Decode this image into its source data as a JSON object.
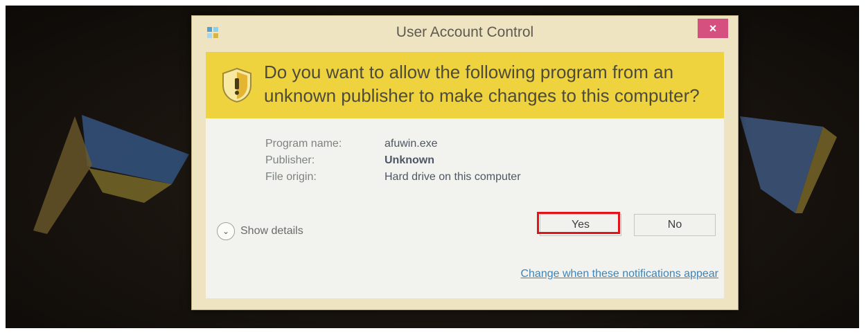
{
  "window": {
    "title": "User Account Control",
    "close_label": "×"
  },
  "banner": {
    "question": "Do you want to allow the following program from an unknown publisher to make changes to this computer?"
  },
  "details": {
    "program_name_label": "Program name:",
    "program_name_value": "afuwin.exe",
    "publisher_label": "Publisher:",
    "publisher_value": "Unknown",
    "file_origin_label": "File origin:",
    "file_origin_value": "Hard drive on this computer"
  },
  "actions": {
    "show_details": "Show details",
    "yes_label": "Yes",
    "no_label": "No",
    "change_notifications_link": "Change when these notifications appear"
  },
  "colors": {
    "banner_yellow": "#efd33e",
    "close_pink": "#d6507f",
    "highlight_red": "#e2141b",
    "link_blue": "#3f83b6"
  },
  "icons": {
    "shield": "uac-shield-icon",
    "app": "uac-app-icon",
    "chevron": "chevron-down-icon"
  }
}
